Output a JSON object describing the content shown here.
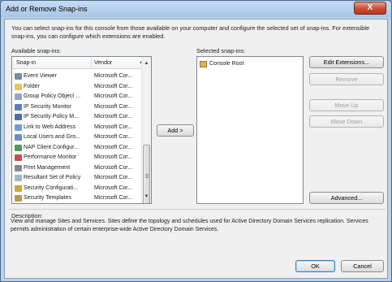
{
  "window": {
    "title": "Add or Remove Snap-ins",
    "close_glyph": "X"
  },
  "intro_text": "You can select snap-ins for this console from those available on your computer and configure the selected set of snap-ins. For extensible snap-ins, you can configure which extensions are enabled.",
  "available": {
    "label": "Available snap-ins:",
    "col_snapin": "Snap-in",
    "col_vendor": "Vendor",
    "rows": [
      {
        "name": "Event Viewer",
        "vendor": "Microsoft Cor...",
        "icon": "event-viewer-icon",
        "color": "#7b8aa6"
      },
      {
        "name": "Folder",
        "vendor": "Microsoft Cor...",
        "icon": "folder-icon",
        "color": "#e8c45c"
      },
      {
        "name": "Group Policy Object ...",
        "vendor": "Microsoft Cor...",
        "icon": "group-policy-icon",
        "color": "#8fa8c8"
      },
      {
        "name": "IP Security Monitor",
        "vendor": "Microsoft Cor...",
        "icon": "ip-security-monitor-icon",
        "color": "#5a7fb8"
      },
      {
        "name": "IP Security Policy M...",
        "vendor": "Microsoft Cor...",
        "icon": "ip-security-policy-icon",
        "color": "#4a6faa"
      },
      {
        "name": "Link to Web Address",
        "vendor": "Microsoft Cor...",
        "icon": "web-link-icon",
        "color": "#6aa0d8"
      },
      {
        "name": "Local Users and Gro...",
        "vendor": "Microsoft Cor...",
        "icon": "local-users-icon",
        "color": "#6c8fc0"
      },
      {
        "name": "NAP Client Configur...",
        "vendor": "Microsoft Cor...",
        "icon": "nap-client-icon",
        "color": "#4f9a5a"
      },
      {
        "name": "Performance Monitor",
        "vendor": "Microsoft Cor...",
        "icon": "performance-monitor-icon",
        "color": "#c0504d"
      },
      {
        "name": "Print Management",
        "vendor": "Microsoft Cor...",
        "icon": "print-management-icon",
        "color": "#7d8a96"
      },
      {
        "name": "Resultant Set of Policy",
        "vendor": "Microsoft Cor...",
        "icon": "resultant-policy-icon",
        "color": "#a3b6cc"
      },
      {
        "name": "Security Configurati...",
        "vendor": "Microsoft Cor...",
        "icon": "security-config-icon",
        "color": "#c9a93c"
      },
      {
        "name": "Security Templates",
        "vendor": "Microsoft Cor...",
        "icon": "security-templates-icon",
        "color": "#b99b48"
      }
    ]
  },
  "add_button": "Add >",
  "selected": {
    "label": "Selected snap-ins:",
    "root": "Console Root"
  },
  "buttons": {
    "edit_extensions": "Edit Extensions...",
    "remove": "Remove",
    "move_up": "Move Up",
    "move_down": "Move Down",
    "advanced": "Advanced...",
    "ok": "OK",
    "cancel": "Cancel"
  },
  "description": {
    "label": "Description:",
    "text": "View and manage Sites and Services. Sites define the topology and schedules used for Active Directory Domain Services replication. Services permits administration of certain enterprise-wide Active Directory Domain Services."
  }
}
